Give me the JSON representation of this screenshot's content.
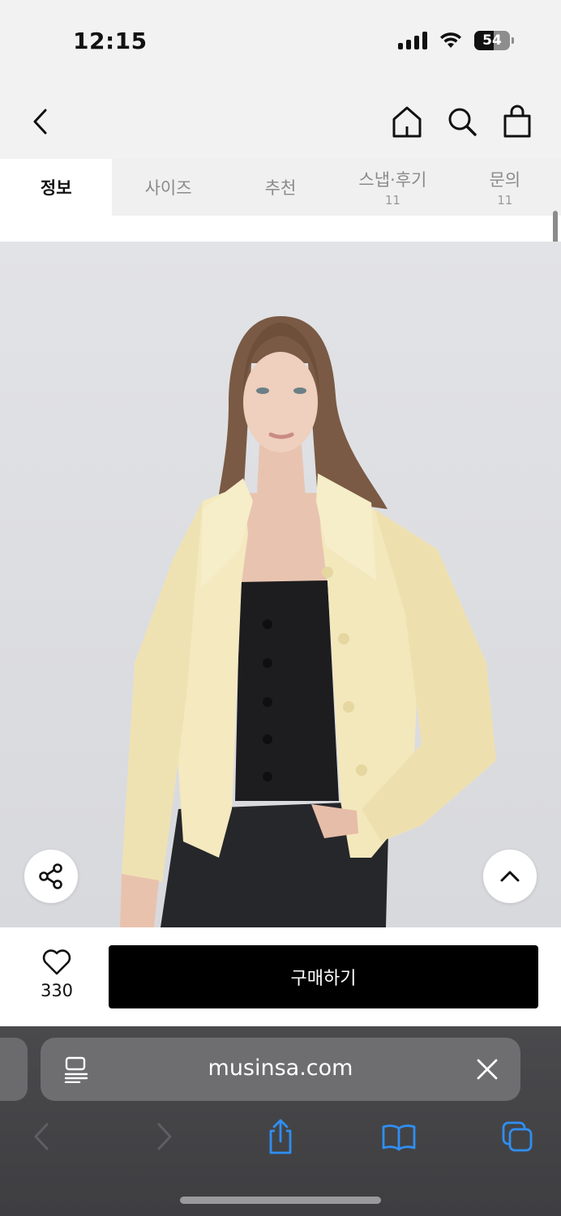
{
  "status": {
    "time": "12:15",
    "battery": "54"
  },
  "nav": {
    "tabs": [
      {
        "label": "정보",
        "count": ""
      },
      {
        "label": "사이즈",
        "count": ""
      },
      {
        "label": "추천",
        "count": ""
      },
      {
        "label": "스냅·후기",
        "count": "11"
      },
      {
        "label": "문의",
        "count": "11"
      }
    ]
  },
  "product": {
    "likes": "330",
    "buy_label": "구매하기"
  },
  "browser": {
    "url": "musinsa.com"
  },
  "icons": {
    "back": "chevron-left-icon",
    "home": "home-icon",
    "search": "search-icon",
    "cart": "shopping-bag-icon",
    "share": "share-icon",
    "scroll_top": "chevron-up-icon",
    "like": "heart-icon",
    "reader": "reader-mode-icon",
    "close": "close-icon",
    "browser_back": "arrow-left-icon",
    "browser_forward": "arrow-right-icon",
    "browser_share": "share-upload-icon",
    "bookmarks": "book-icon",
    "tabs": "tabs-icon"
  },
  "colors": {
    "buy_button": "#000000",
    "browser_bar": "#434346",
    "tab_active_bg": "#ffffff",
    "tab_inactive_bg": "#f0f0f0",
    "browser_icon": "#2f8ff2"
  }
}
